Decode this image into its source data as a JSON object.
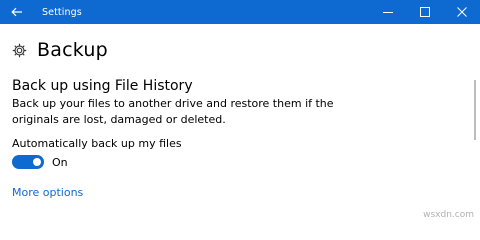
{
  "titlebar": {
    "title": "Settings",
    "background": "#0e6ad1",
    "back_icon": "arrow-left-icon",
    "minimize_icon": "minimize-icon",
    "maximize_icon": "maximize-icon",
    "close_icon": "close-icon"
  },
  "page": {
    "title": "Backup",
    "icon": "gear-icon"
  },
  "file_history": {
    "heading": "Back up using File History",
    "description": "Back up your files to another drive and restore them if the originals are lost, damaged or deleted.",
    "toggle_label": "Automatically back up my files",
    "toggle_state": "On",
    "toggle_on": true,
    "accent": "#0e6ad1",
    "more_options": "More options"
  },
  "watermark": "wsxdn.com"
}
